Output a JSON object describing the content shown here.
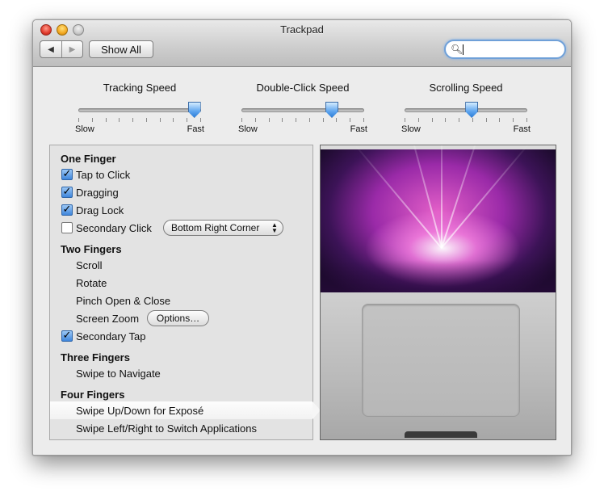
{
  "window": {
    "title": "Trackpad",
    "nav_back": "◀",
    "nav_forward": "▶",
    "show_all": "Show All",
    "search_icon": "search-icon",
    "search_value": ""
  },
  "sliders": [
    {
      "label": "Tracking Speed",
      "min_label": "Slow",
      "max_label": "Fast",
      "value": 0.97,
      "ticks": 10
    },
    {
      "label": "Double-Click Speed",
      "min_label": "Slow",
      "max_label": "Fast",
      "value": 0.75,
      "ticks": 10
    },
    {
      "label": "Scrolling Speed",
      "min_label": "Slow",
      "max_label": "Fast",
      "value": 0.55,
      "ticks": 10
    }
  ],
  "gestures": {
    "one_finger": {
      "header": "One Finger",
      "tap_to_click": {
        "label": "Tap to Click",
        "checked": true
      },
      "dragging": {
        "label": "Dragging",
        "checked": true
      },
      "drag_lock": {
        "label": "Drag Lock",
        "checked": true
      },
      "secondary_click": {
        "label": "Secondary Click",
        "checked": false,
        "option": "Bottom Right Corner"
      }
    },
    "two_fingers": {
      "header": "Two Fingers",
      "scroll": "Scroll",
      "rotate": "Rotate",
      "pinch": "Pinch Open & Close",
      "screen_zoom": "Screen Zoom",
      "options_button": "Options…",
      "secondary_tap": {
        "label": "Secondary Tap",
        "checked": true
      }
    },
    "three_fingers": {
      "header": "Three Fingers",
      "swipe_navigate": "Swipe to Navigate"
    },
    "four_fingers": {
      "header": "Four Fingers",
      "swipe_expose": "Swipe Up/Down for Exposé",
      "swipe_switch": "Swipe Left/Right to Switch Applications"
    }
  },
  "colors": {
    "selection_accent": "#3f86dc",
    "window_bg": "#ececec"
  }
}
